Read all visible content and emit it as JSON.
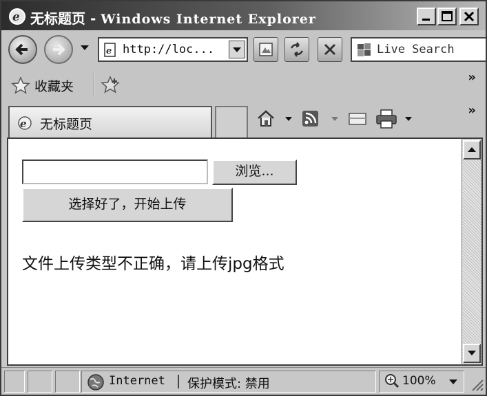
{
  "window": {
    "title": "无标题页",
    "app_name": "Windows Internet Explorer",
    "title_sep": "-"
  },
  "address_bar": {
    "url": "http://loc..."
  },
  "search": {
    "placeholder": "Live Search"
  },
  "favorites": {
    "label": "收藏夹"
  },
  "tab": {
    "label": "无标题页"
  },
  "page": {
    "file_input_value": "",
    "browse_label": "浏览...",
    "upload_label": "选择好了，开始上传",
    "error_message": "文件上传类型不正确，请上传jpg格式"
  },
  "status": {
    "zone": "Internet",
    "protected_mode": "保护模式: 禁用",
    "zoom": "100%"
  },
  "icons": [
    "ie-logo-icon",
    "minimize-icon",
    "maximize-icon",
    "close-icon",
    "back-arrow-icon",
    "forward-arrow-icon",
    "dropdown-arrow-icon",
    "page-icon",
    "compatibility-icon",
    "refresh-icon",
    "stop-icon",
    "live-search-icon",
    "favorites-star-icon",
    "add-favorite-icon",
    "home-icon",
    "feeds-icon",
    "read-mail-icon",
    "print-icon",
    "globe-icon",
    "zoom-icon",
    "resize-grip-icon"
  ]
}
